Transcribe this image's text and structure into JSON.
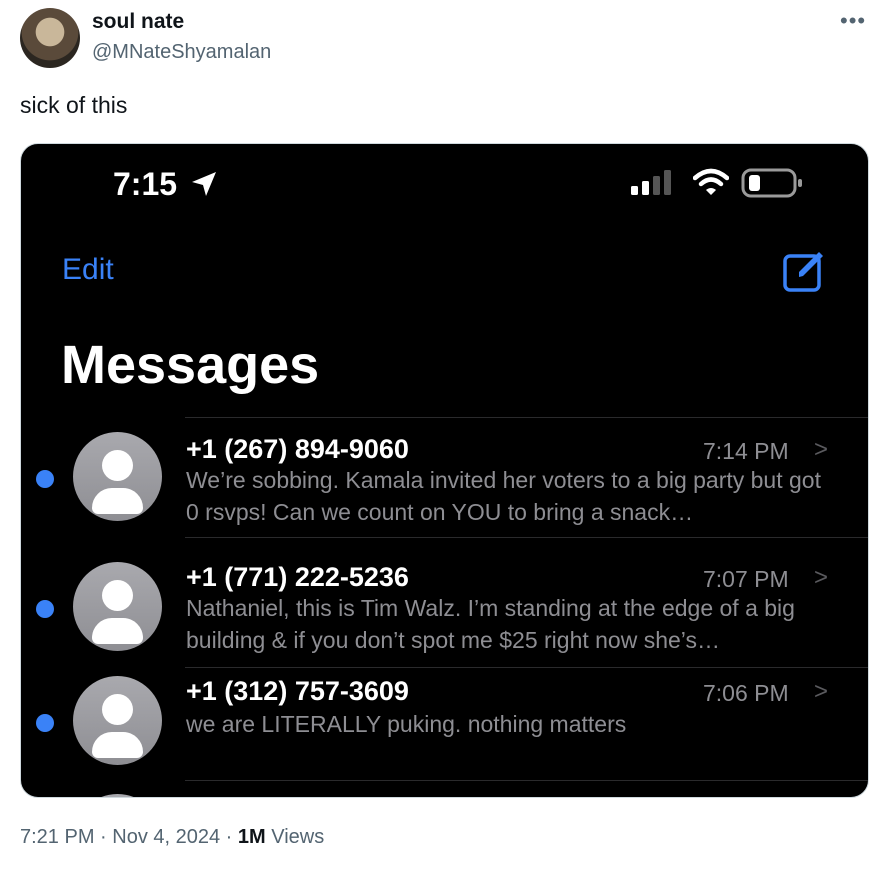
{
  "tweet": {
    "display_name": "soul nate",
    "handle": "@MNateShyamalan",
    "more_icon": "more-icon",
    "text": "sick of this",
    "timestamp": "7:21 PM · Nov 4, 2024 · ",
    "views_count": "1M",
    "views_label": " Views"
  },
  "phone": {
    "status_time": "7:15",
    "edit_label": "Edit",
    "title": "Messages",
    "accent_color": "#3a82f7",
    "conversations": [
      {
        "sender": "+1 (267) 894-9060",
        "time": "7:14 PM",
        "preview": "We’re sobbing. Kamala invited her voters to a big party but got 0 rsvps! Can we count on YOU to bring a snack…",
        "unread": true
      },
      {
        "sender": "+1 (771) 222-5236",
        "time": "7:07 PM",
        "preview": "Nathaniel, this is Tim Walz. I’m standing at the edge of a big building & if you don’t spot me $25 right now she’s…",
        "unread": true
      },
      {
        "sender": "+1 (312) 757-3609",
        "time": "7:06 PM",
        "preview": "we are LITERALLY puking. nothing matters",
        "unread": true
      }
    ]
  }
}
